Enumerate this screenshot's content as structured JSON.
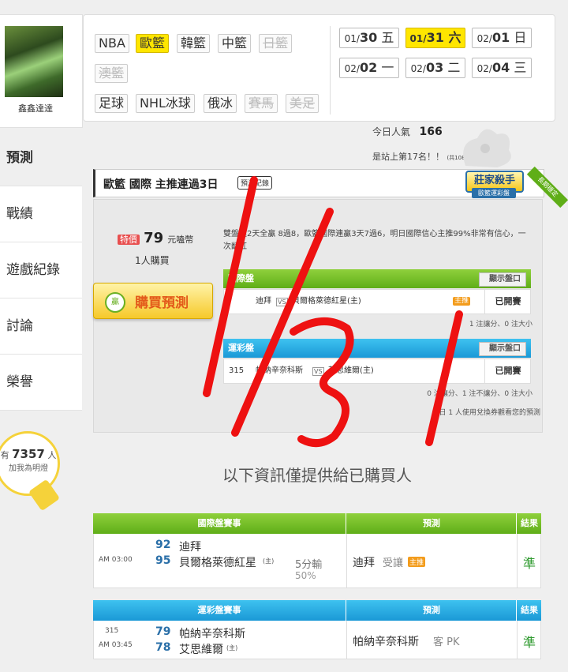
{
  "user": {
    "name": "鑫鑫達達"
  },
  "nav": [
    {
      "label": "預測",
      "active": true
    },
    {
      "label": "戰績",
      "active": false
    },
    {
      "label": "遊戲紀錄",
      "active": false
    },
    {
      "label": "討論",
      "active": false
    },
    {
      "label": "榮譽",
      "active": false
    }
  ],
  "bulb": {
    "prefix": "有",
    "count": "7357",
    "suffix": "人",
    "text": "加我為明燈"
  },
  "leagues": {
    "row1": [
      "NBA",
      "歐籃",
      "韓籃",
      "中籃",
      "日籃"
    ],
    "row2": [
      "澳籃"
    ],
    "row3": [
      "足球",
      "NHL冰球",
      "俄冰",
      "賽馬",
      "美足"
    ]
  },
  "dates": [
    {
      "md": "01/",
      "d": "30",
      "w": "五"
    },
    {
      "md": "01/",
      "d": "31",
      "w": "六"
    },
    {
      "md": "02/",
      "d": "01",
      "w": "日"
    },
    {
      "md": "02/",
      "d": "02",
      "w": "一"
    },
    {
      "md": "02/",
      "d": "03",
      "w": "二"
    },
    {
      "md": "02/",
      "d": "04",
      "w": "三"
    }
  ],
  "popularity": {
    "label": "今日人氣",
    "value": "166",
    "rank_text": "是站上第17名！！",
    "rank_sub": "(共10873人)"
  },
  "prediction": {
    "title": "歐籃 國際 主推連過3日",
    "record_btn": "預測紀錄",
    "badge_main": "莊家殺手",
    "badge_sub": "歐籃運彩盤",
    "badge_corner": "長期穩定",
    "price_tag": "特價",
    "price": "79",
    "price_unit": "元嗑幣",
    "buyers": "1人購買",
    "buy_label": "購買預測",
    "buy_icon": "贏",
    "description": "雙盤連2天全贏 8過8，歐籃國際連贏3天7過6，明日國際信心主推99%非常有信心，一次翻紅",
    "intl": {
      "header": "國際盤",
      "show_btn": "顯示盤口",
      "away": "迪拜",
      "home": "貝爾格萊德紅星(主)",
      "host_badge": "主推",
      "status": "已開賽",
      "note": "1 注讓分、0 注大小"
    },
    "sport": {
      "header": "運彩盤",
      "show_btn": "顯示盤口",
      "num": "315",
      "away": "帕納辛奈科斯",
      "home": "艾思維爾(主)",
      "status": "已開賽",
      "note": "0 注讓分、1 注不讓分、0 注大小",
      "footer": "今日 1 人使用兌換券觀看您的預測"
    },
    "vs": "VS"
  },
  "notice": "以下資訊僅提供給已購買人",
  "table1": {
    "head": [
      "國際盤賽事",
      "預測",
      "結果"
    ],
    "time": "AM 03:00",
    "away_num": "92",
    "away": "迪拜",
    "home_num": "95",
    "home": "貝爾格萊德紅星",
    "home_tag": "(主)",
    "spread": "5分輸",
    "spread_pct": "50%",
    "pick": "迪拜",
    "pick_type": "受讓",
    "pick_badge": "主推",
    "result": "準"
  },
  "table2": {
    "head": [
      "運彩盤賽事",
      "預測",
      "結果"
    ],
    "num": "315",
    "time": "AM 03:45",
    "away_num": "79",
    "away": "帕納辛奈科斯",
    "home_num": "78",
    "home": "艾思維爾",
    "home_tag": "(主)",
    "pick": "帕納辛奈科斯",
    "pick_type": "客 PK",
    "result": "準"
  },
  "colors": {
    "accent_yellow": "#ffe600",
    "green": "#5fae18",
    "blue": "#1a98d6",
    "scribble_red": "#ee1111"
  }
}
